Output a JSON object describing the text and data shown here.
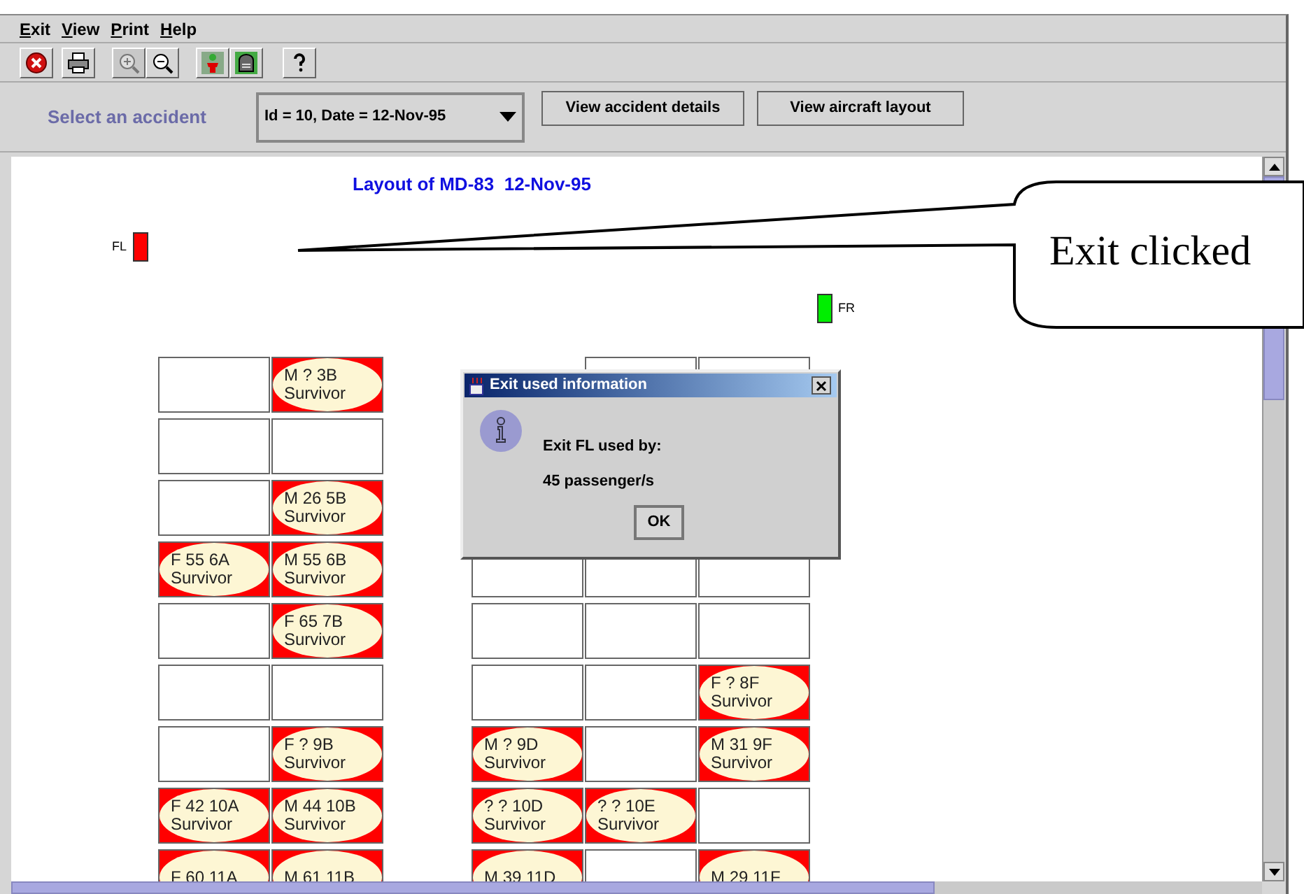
{
  "menu": [
    "Exit",
    "View",
    "Print",
    "Help"
  ],
  "toolbar": [
    {
      "kind": "exit",
      "disabled": false
    },
    {
      "kind": "print",
      "disabled": false
    },
    {
      "kind": "zoom-in",
      "disabled": true
    },
    {
      "kind": "zoom-out",
      "disabled": false
    },
    {
      "kind": "person",
      "disabled": false
    },
    {
      "kind": "tombstone",
      "disabled": false
    },
    {
      "kind": "help",
      "disabled": false
    }
  ],
  "selector": {
    "label": "Select an accident",
    "value": "Id = 10, Date = 12-Nov-95",
    "buttons": [
      "View accident details",
      "View aircraft layout"
    ]
  },
  "layout": {
    "title": "Layout of MD-83  12-Nov-95",
    "exits": [
      {
        "label": "FL",
        "color": "#ff0000"
      },
      {
        "label": "FR",
        "color": "#00ee00"
      }
    ],
    "rows": [
      {
        "left": [
          {
            "occupied": false
          },
          {
            "occupied": true,
            "label": "M ? 3B",
            "status": "Survivor"
          }
        ],
        "right_shifted": true,
        "right": [
          {
            "occupied": false
          },
          {
            "occupied": false
          }
        ]
      },
      {
        "left": [
          {
            "occupied": false
          },
          {
            "occupied": false
          }
        ],
        "right": []
      },
      {
        "left": [
          {
            "occupied": false
          },
          {
            "occupied": true,
            "label": "M 26 5B",
            "status": "Survivor"
          }
        ],
        "right": []
      },
      {
        "left": [
          {
            "occupied": true,
            "label": "F 55 6A",
            "status": "Survivor"
          },
          {
            "occupied": true,
            "label": "M 55 6B",
            "status": "Survivor"
          }
        ],
        "right": [
          {
            "occupied": false
          },
          {
            "occupied": false
          },
          {
            "occupied": false
          }
        ]
      },
      {
        "left": [
          {
            "occupied": false
          },
          {
            "occupied": true,
            "label": "F 65 7B",
            "status": "Survivor"
          }
        ],
        "right": [
          {
            "occupied": false
          },
          {
            "occupied": false
          },
          {
            "occupied": false
          }
        ]
      },
      {
        "left": [
          {
            "occupied": false
          },
          {
            "occupied": false
          }
        ],
        "right": [
          {
            "occupied": false
          },
          {
            "occupied": false
          },
          {
            "occupied": true,
            "label": "F ? 8F",
            "status": "Survivor"
          }
        ]
      },
      {
        "left": [
          {
            "occupied": false
          },
          {
            "occupied": true,
            "label": "F ? 9B",
            "status": "Survivor"
          }
        ],
        "right": [
          {
            "occupied": true,
            "label": "M ? 9D",
            "status": "Survivor"
          },
          {
            "occupied": false
          },
          {
            "occupied": true,
            "label": "M 31 9F",
            "status": "Survivor"
          }
        ]
      },
      {
        "left": [
          {
            "occupied": true,
            "label": "F 42 10A",
            "status": "Survivor"
          },
          {
            "occupied": true,
            "label": "M 44 10B",
            "status": "Survivor"
          }
        ],
        "right": [
          {
            "occupied": true,
            "label": "? ? 10D",
            "status": "Survivor"
          },
          {
            "occupied": true,
            "label": "? ? 10E",
            "status": "Survivor"
          },
          {
            "occupied": false
          }
        ]
      },
      {
        "left": [
          {
            "occupied": true,
            "label": "F 60 11A"
          },
          {
            "occupied": true,
            "label": "M 61 11B"
          }
        ],
        "right": [
          {
            "occupied": true,
            "label": "M 39 11D"
          },
          {
            "occupied": false
          },
          {
            "occupied": true,
            "label": "M 29 11F"
          }
        ]
      }
    ]
  },
  "dialog": {
    "title": "Exit used information",
    "lines": [
      "Exit FL used by:",
      "45 passenger/s"
    ],
    "button": "OK"
  },
  "callout": {
    "text": "Exit clicked"
  }
}
